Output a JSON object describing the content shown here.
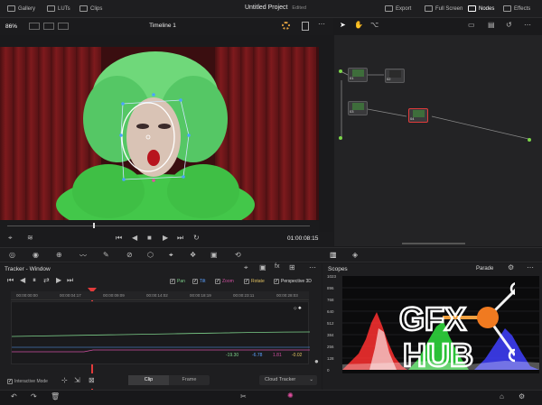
{
  "topbar": {
    "gallery": "Gallery",
    "luts": "LUTs",
    "clips": "Clips",
    "project_title": "Untitled Project",
    "project_status": "Edited",
    "export": "Export",
    "full_screen": "Full Screen",
    "nodes": "Nodes",
    "effects": "Effects"
  },
  "viewer": {
    "zoom": "86%",
    "timeline": "Timeline 1",
    "timecode": "01:00:08:15"
  },
  "nodes": {
    "items": [
      "01",
      "02",
      "03",
      "04"
    ]
  },
  "tracker": {
    "title": "Tracker - Window",
    "pan": "Pan",
    "tilt": "Tilt",
    "zoom": "Zoom",
    "rotate": "Rotate",
    "perspective": "Perspective 3D",
    "timecodes": [
      "00:00:00:00",
      "00:00:04:17",
      "00:00:09:09",
      "00:00:14:02",
      "00:00:18:19",
      "00:00:23:11",
      "00:00:28:03"
    ],
    "values": [
      "-19.30",
      "-6.78",
      "1.81",
      "-0.02"
    ],
    "interactive_mode": "Interactive Mode",
    "clip_tab": "Clip",
    "frame_tab": "Frame",
    "cloud_tracker": "Cloud Tracker"
  },
  "scopes": {
    "title": "Scopes",
    "mode": "Parade",
    "scale": [
      "1023",
      "896",
      "768",
      "640",
      "512",
      "384",
      "256",
      "128",
      "0"
    ]
  },
  "colors": {
    "accent": "#4ba3ff",
    "playhead": "#e23b3b",
    "pan_line": "#7dd08a",
    "zoom_line": "#d04fa0"
  },
  "watermark": "GFX HUB"
}
